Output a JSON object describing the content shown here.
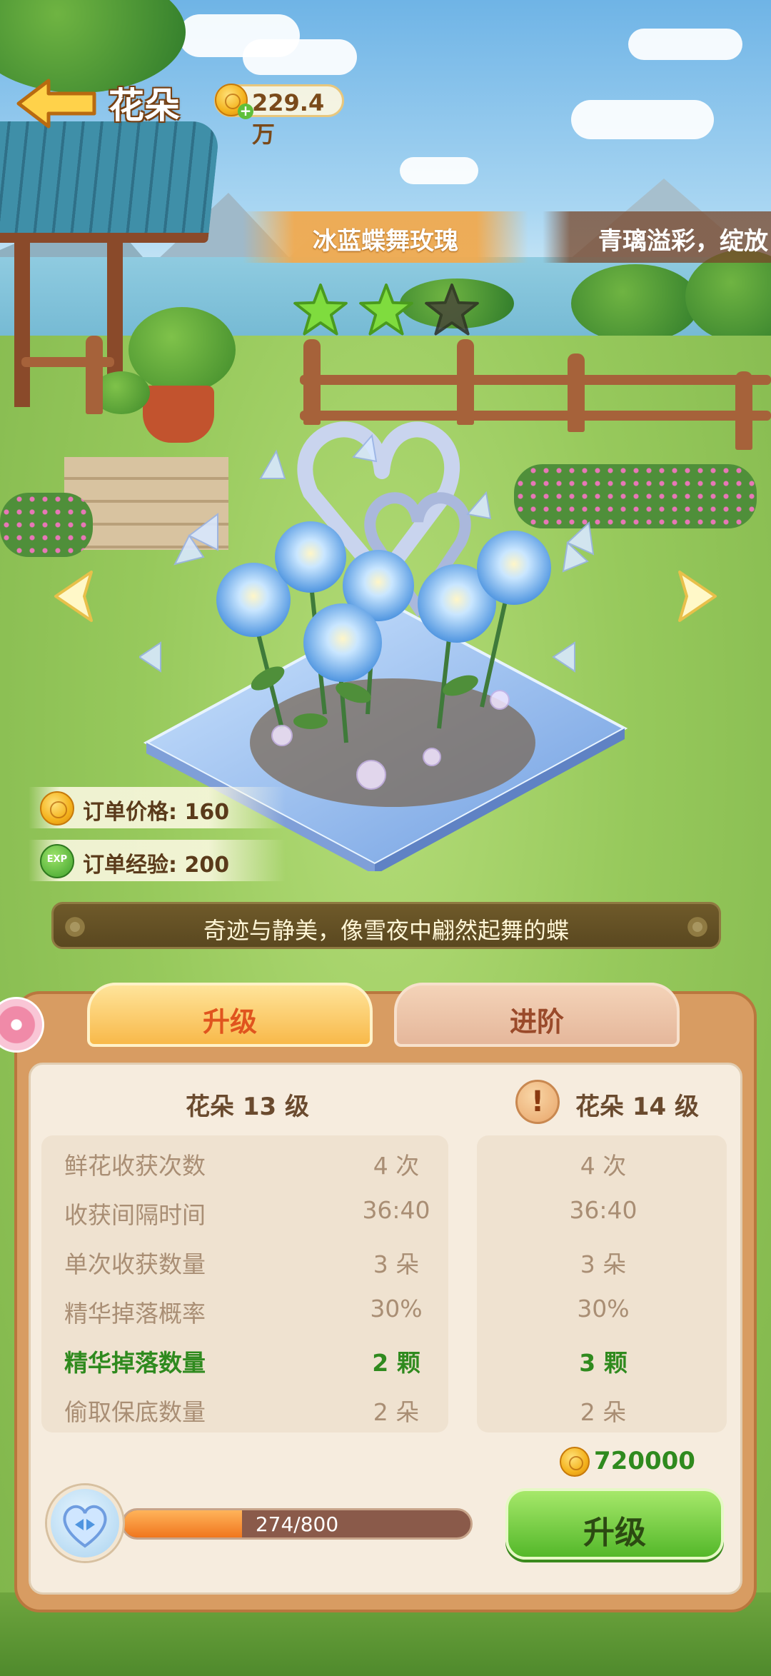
{
  "header": {
    "title": "花朵",
    "coins": "229.4万"
  },
  "flower": {
    "name": "冰蓝蝶舞玫瑰",
    "next_name_preview": "青璃溢彩，绽放",
    "stars_filled": 2,
    "stars_total": 3,
    "order_price": "订单价格: 160",
    "order_exp": "订单经验: 200",
    "exp_icon_text": "EXP",
    "description": "奇迹与静美，像雪夜中翩然起舞的蝶"
  },
  "tabs": {
    "upgrade": "升级",
    "advance": "进阶"
  },
  "levels": {
    "current": "花朵 13 级",
    "next": "花朵 14 级"
  },
  "stats": [
    {
      "label": "鲜花收获次数",
      "current": "4 次",
      "next": "4 次",
      "highlight": false
    },
    {
      "label": "收获间隔时间",
      "current": "36:40",
      "next": "36:40",
      "highlight": false
    },
    {
      "label": "单次收获数量",
      "current": "3 朵",
      "next": "3 朵",
      "highlight": false
    },
    {
      "label": "精华掉落概率",
      "current": "30%",
      "next": "30%",
      "highlight": false
    },
    {
      "label": "精华掉落数量",
      "current": "2 颗",
      "next": "3 颗",
      "highlight": true
    },
    {
      "label": "偷取保底数量",
      "current": "2 朵",
      "next": "2 朵",
      "highlight": false
    }
  ],
  "upgrade": {
    "cost": "720000",
    "progress_text": "274/800",
    "progress_value": 274,
    "progress_max": 800,
    "button_label": "升级"
  },
  "colors": {
    "highlight_green": "#2f8a1e",
    "tab_active": "#e0541e"
  }
}
